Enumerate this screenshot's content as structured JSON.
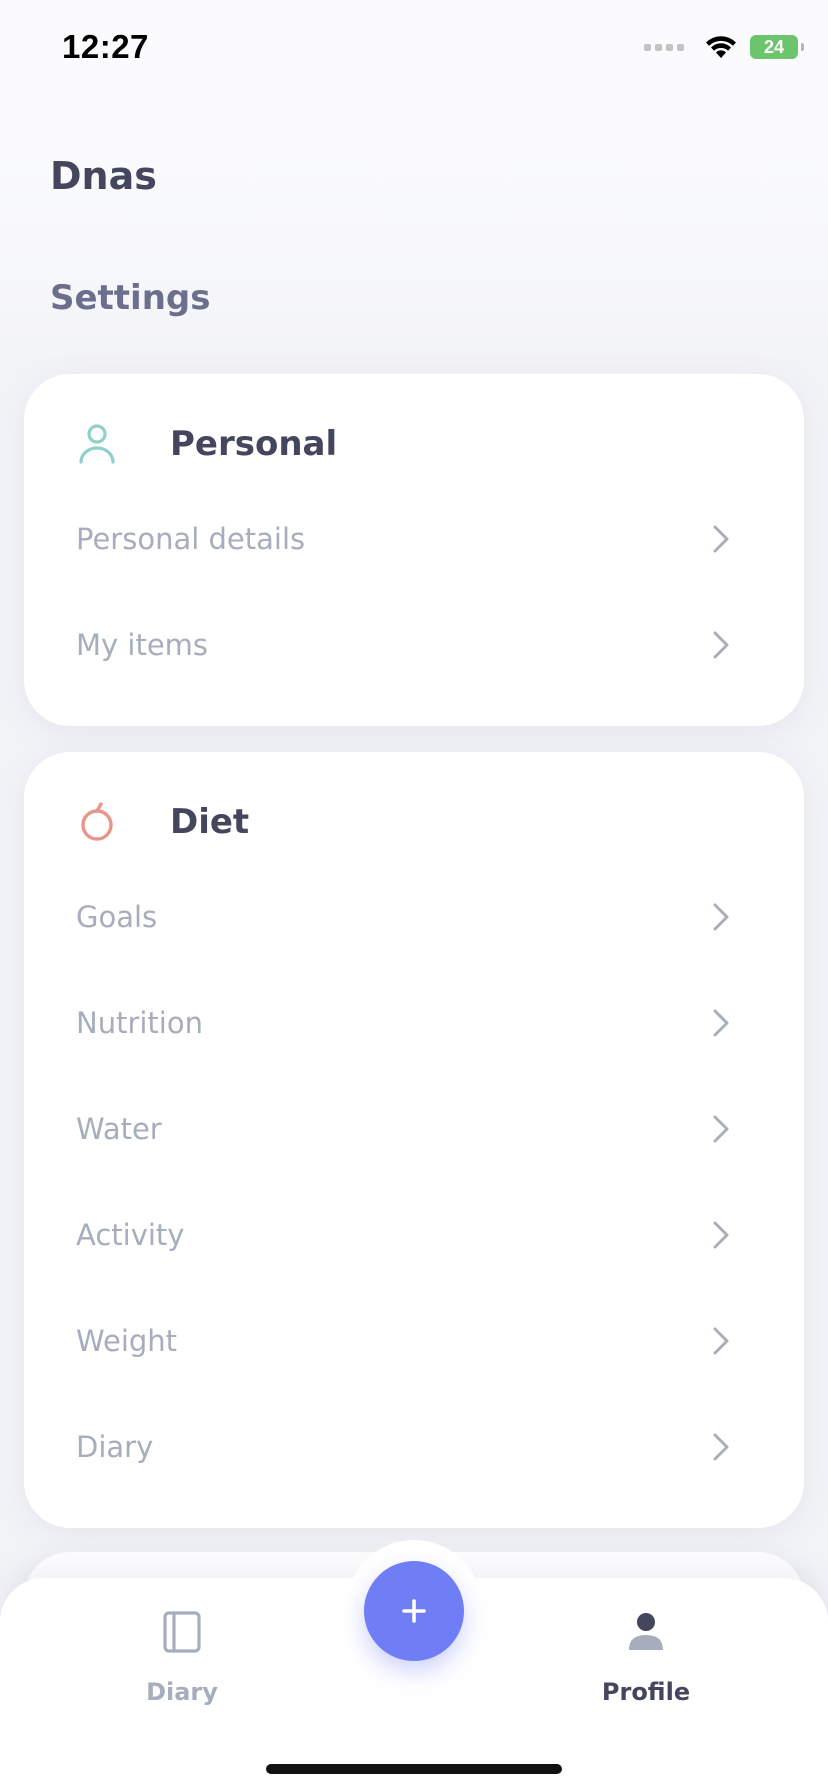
{
  "status_bar": {
    "time": "12:27",
    "battery": "24"
  },
  "profile": {
    "user_name": "Dnas"
  },
  "settings": {
    "title": "Settings",
    "sections": [
      {
        "title": "Personal",
        "icon": "person-icon",
        "icon_color": "#8fd1c8",
        "items": [
          {
            "label": "Personal details"
          },
          {
            "label": "My items"
          }
        ]
      },
      {
        "title": "Diet",
        "icon": "apple-icon",
        "icon_color": "#e8958a",
        "items": [
          {
            "label": "Goals"
          },
          {
            "label": "Nutrition"
          },
          {
            "label": "Water"
          },
          {
            "label": "Activity"
          },
          {
            "label": "Weight"
          },
          {
            "label": "Diary"
          }
        ]
      }
    ]
  },
  "tab_bar": {
    "diary_label": "Diary",
    "profile_label": "Profile",
    "add_button": "add-icon",
    "active_tab": "Profile",
    "accent_color": "#6f7ef4"
  }
}
